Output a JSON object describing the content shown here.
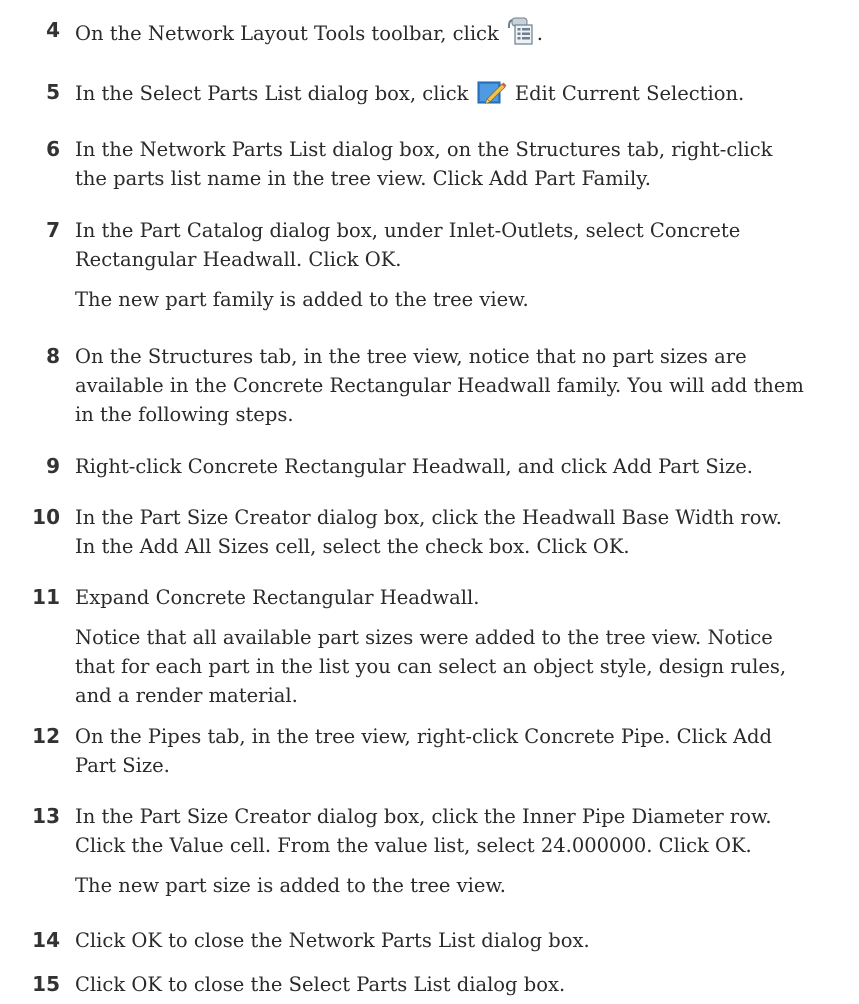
{
  "steps": [
    {
      "number": "4",
      "lines": [
        "On the Network Layout Tools toolbar, click"
      ],
      "after_icon": ".",
      "icon": "parts-list-icon"
    },
    {
      "number": "5",
      "before_icon": "In the Select Parts List dialog box, click",
      "after_icon": "Edit Current Selection.",
      "icon": "edit-pencil-icon"
    },
    {
      "number": "6",
      "lines": [
        "In the Network Parts List dialog box, on the Structures tab, right-click",
        "the parts list name in the tree view. Click Add Part Family."
      ]
    },
    {
      "number": "7",
      "lines": [
        "In the Part Catalog dialog box, under Inlet-Outlets, select Concrete",
        "Rectangular Headwall. Click OK."
      ],
      "note": "The new part family is added to the tree view."
    },
    {
      "number": "8",
      "lines": [
        "On the Structures tab, in the tree view, notice that no part sizes are",
        "available in the Concrete Rectangular Headwall family. You will add them",
        "in the following steps."
      ]
    },
    {
      "number": "9",
      "lines": [
        "Right-click Concrete Rectangular Headwall, and click Add Part Size."
      ]
    },
    {
      "number": "10",
      "lines": [
        "In the Part Size Creator dialog box, click the Headwall Base Width row.",
        "In the Add All Sizes cell, select the check box. Click OK."
      ]
    },
    {
      "number": "11",
      "lines": [
        "Expand Concrete Rectangular Headwall."
      ],
      "note_lines": [
        "Notice that all available part sizes were added to the tree view. Notice",
        "that for each part in the list you can select an object style, design rules,",
        "and a render material."
      ]
    },
    {
      "number": "12",
      "lines": [
        "On the Pipes tab, in the tree view, right-click Concrete Pipe. Click Add",
        "Part Size."
      ]
    },
    {
      "number": "13",
      "lines": [
        "In the Part Size Creator dialog box, click the Inner Pipe Diameter row.",
        "Click the Value cell. From the value list, select 24.000000. Click OK."
      ],
      "note": "The new part size is added to the tree view."
    },
    {
      "number": "14",
      "lines": [
        "Click OK to close the Network Parts List dialog box."
      ]
    },
    {
      "number": "15",
      "lines": [
        "Click OK to close the Select Parts List dialog box."
      ]
    }
  ]
}
